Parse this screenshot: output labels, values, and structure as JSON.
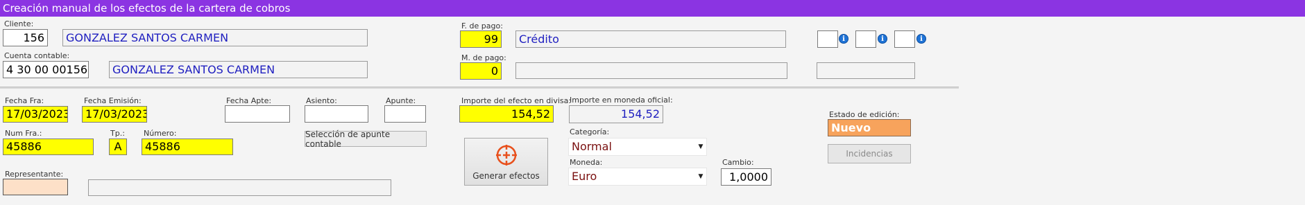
{
  "window": {
    "title": "Creación manual de los efectos de la cartera de cobros"
  },
  "cliente": {
    "label": "Cliente:",
    "code": "156",
    "name": "GONZALEZ SANTOS CARMEN"
  },
  "cuenta": {
    "label": "Cuenta contable:",
    "code": "4 30 00 00156",
    "name": "GONZALEZ SANTOS CARMEN"
  },
  "forma_pago": {
    "label": "F. de pago:",
    "code": "99",
    "name": "Crédito"
  },
  "medio_pago": {
    "label": "M. de pago:",
    "code": "0",
    "name": ""
  },
  "fecha_fra": {
    "label": "Fecha Fra:",
    "value": "17/03/2023"
  },
  "fecha_emision": {
    "label": "Fecha Emisión:",
    "value": "17/03/2023"
  },
  "fecha_apte": {
    "label": "Fecha Apte:",
    "value": ""
  },
  "asiento": {
    "label": "Asiento:",
    "value": ""
  },
  "apunte": {
    "label": "Apunte:",
    "value": ""
  },
  "num_fra": {
    "label": "Num Fra.:",
    "value": "45886"
  },
  "tp": {
    "label": "Tp.:",
    "value": "A"
  },
  "numero": {
    "label": "Número:",
    "value": "45886"
  },
  "seleccion_button": "Selección de apunte contable",
  "representante": {
    "label": "Representante:",
    "code": "",
    "name": ""
  },
  "importe_divisa": {
    "label": "Importe del efecto en divisa:",
    "value": "154,52"
  },
  "importe_oficial": {
    "label": "Importe en moneda oficial:",
    "value": "154,52"
  },
  "generar_button": "Generar efectos",
  "categoria": {
    "label": "Categoría:",
    "value": "Normal"
  },
  "moneda": {
    "label": "Moneda:",
    "value": "Euro"
  },
  "cambio": {
    "label": "Cambio:",
    "value": "1,0000"
  },
  "estado": {
    "label": "Estado de edición:",
    "value": "Nuevo"
  },
  "incidencias_button": "Incidencias",
  "icons": {
    "info": "info-icon",
    "dropdown": "chevron-down-icon",
    "generate": "crosshair-plus-icon"
  },
  "colors": {
    "titlebar": "#8b34e2",
    "required": "#ffff00",
    "estado": "#f7a35c",
    "value_blue": "#2020c0",
    "value_red": "#7a1010"
  }
}
